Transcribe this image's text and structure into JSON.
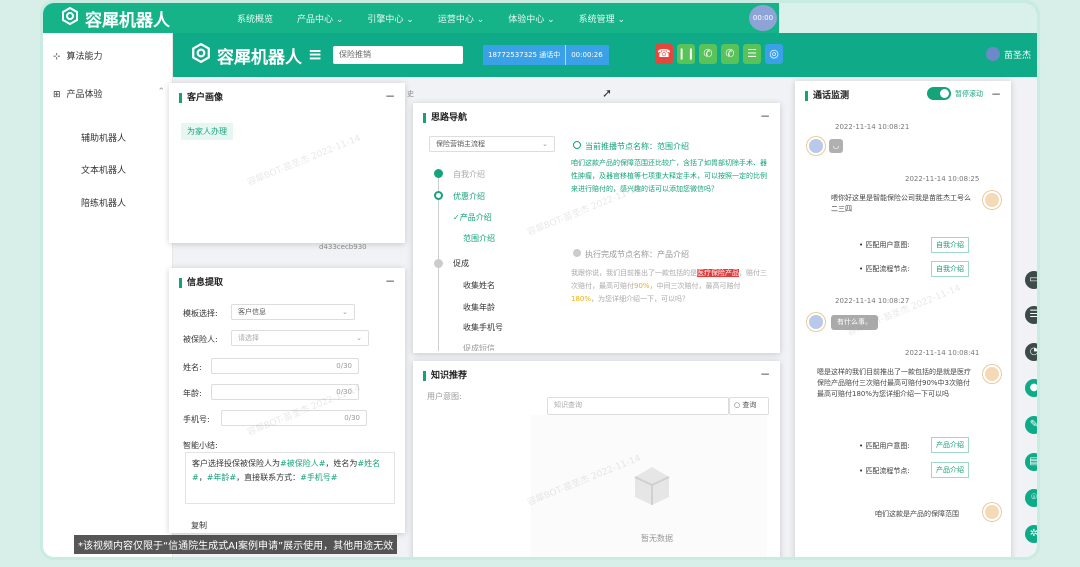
{
  "topnav": {
    "brand": "容犀机器人",
    "items": [
      "系统概览",
      "产品中心 ⌄",
      "引擎中心 ⌄",
      "运营中心 ⌄",
      "体验中心 ⌄",
      "系统管理 ⌄"
    ],
    "avatar_text": "00:00"
  },
  "sidebar": {
    "item1": "算法能力",
    "item2": "产品体验",
    "sub": [
      "辅助机器人",
      "文本机器人",
      "陪练机器人"
    ]
  },
  "header": {
    "brand": "容犀机器人",
    "menu_icon": "≡",
    "select_value": "保险推销",
    "call_number": "18772537325 通话中",
    "call_timer": "00:00:26",
    "user": "苗圣杰"
  },
  "customer_panel": {
    "title": "客户画像",
    "tag": "为家人办理",
    "id_text": "d433cecb930",
    "stray": "史"
  },
  "info_panel": {
    "title": "信息提取",
    "template_label": "模板选择:",
    "template_value": "客户信息",
    "insured_label": "被保险人:",
    "insured_placeholder": "请选择",
    "name_label": "姓名:",
    "name_count": "0/30",
    "age_label": "年龄:",
    "age_count": "0/30",
    "phone_label": "手机号:",
    "phone_count": "0/30",
    "summary_label": "智能小结:",
    "summary_p1": "客户选择投保被保险人为",
    "summary_v1": "#被保险人#",
    "summary_p2": "，姓名为",
    "summary_v2": "#姓名#",
    "summary_p3": "，",
    "summary_v3": "#年龄#",
    "summary_p4": "，直接联系方式：",
    "summary_v4": "#手机号#",
    "copy": "复制"
  },
  "mindmap": {
    "title": "思路导航",
    "flow_select": "保险营销主流程",
    "current_node": "当前推播节点名称：范围介绍",
    "steps": [
      "自我介绍",
      "优惠介绍",
      "✓产品介绍",
      "范围介绍",
      "促成",
      "收集姓名",
      "收集年龄",
      "收集手机号",
      "促成短信"
    ],
    "script": "咱们这款产品的保障范围还比较广，含括了如胃部切除手术、器性肿瘤，及器官移植等七项重大释定手术，可以按照一定的比例来进行赔付的，感兴趣的话可以添加您微信吗？",
    "next_node": "执行完成节点名称：产品介绍",
    "next_text_a": "我跟你说，我们目前推出了一款包括的是",
    "next_hl": "医疗保险产品",
    "next_text_b": "，赔付三次赔付，最高可赔付",
    "next_pct1": "90%",
    "next_text_c": "，中间三次赔付，最高可赔付",
    "next_pct2": "180%",
    "next_text_d": "，为您详细介绍一下，可以吗？"
  },
  "knowledge": {
    "title": "知识推荐",
    "user_intent": "用户意图:",
    "search_placeholder": "知识查询",
    "search_btn": "查询",
    "empty": "暂无数据"
  },
  "monitor": {
    "title": "通话监测",
    "toggle_label": "暂停滚动",
    "t1": "2022-11-14 10:08:21",
    "t2": "2022-11-14 10:08:25",
    "msg2": "喂你好这里是智能保险公司我是苗胜杰工号么二三四",
    "intent_label": "• 匹配用户意图:",
    "node_label": "• 匹配流程节点:",
    "btn_self": "自我介绍",
    "t3": "2022-11-14 10:08:27",
    "msg3": "有什么事。",
    "t4": "2022-11-14 10:08:41",
    "msg4": "嗯是这样的我们目前推出了一款包括的是就是医疗保险产品赔付三次赔付最高可赔付90%中3次赔付最高可赔付180%为您详细介绍一下可以吗",
    "btn_product": "产品介绍",
    "msg5": "咱们这款是产品的保障范围"
  },
  "disclaimer": "*该视频内容仅限于“信通院生成式AI案例申请”展示使用，其他用途无效",
  "colors": {
    "primary": "#16b389",
    "header": "#0faa87",
    "accent": "#14a37a",
    "highlight": "#e23b3b"
  }
}
